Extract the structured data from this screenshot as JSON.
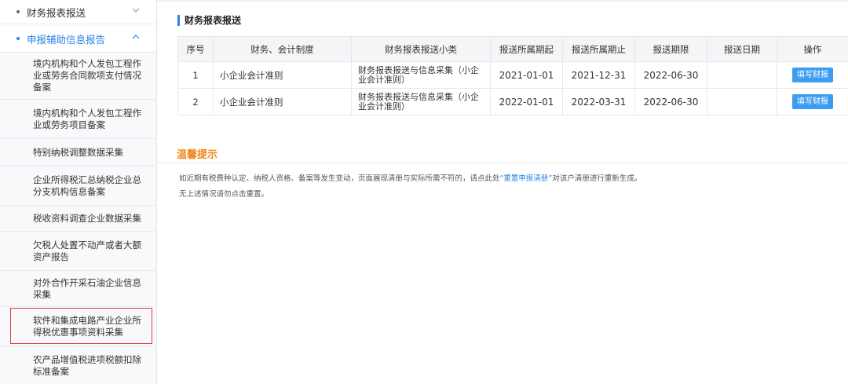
{
  "sidebar": {
    "top_items": [
      {
        "label": "财务报表报送",
        "expanded": false
      },
      {
        "label": "申报辅助信息报告",
        "expanded": true
      }
    ],
    "sub_items": [
      {
        "lines": [
          "境内机构和个人发包工程作",
          "业或劳务合同款项支付情况",
          "备案"
        ]
      },
      {
        "lines": [
          "境内机构和个人发包工程作",
          "业或劳务项目备案"
        ]
      },
      {
        "lines": [
          "特别纳税调整数据采集"
        ]
      },
      {
        "lines": [
          "企业所得税汇总纳税企业总",
          "分支机构信息备案"
        ]
      },
      {
        "lines": [
          "税收资料调查企业数据采集"
        ]
      },
      {
        "lines": [
          "欠税人处置不动产或者大额",
          "资产报告"
        ]
      },
      {
        "lines": [
          "对外合作开采石油企业信息",
          "采集"
        ]
      },
      {
        "lines": [
          "软件和集成电路产业企业所",
          "得税优惠事项资料采集"
        ]
      },
      {
        "lines": [
          "农产品增值税进项税额扣除",
          "标准备案"
        ]
      }
    ]
  },
  "main": {
    "section_title": "财务报表报送",
    "table": {
      "headers": [
        "序号",
        "财务、会计制度",
        "财务报表报送小类",
        "报送所属期起",
        "报送所属期止",
        "报送期限",
        "报送日期",
        "操作"
      ],
      "rows": [
        {
          "no": "1",
          "system": "小企业会计准则",
          "sub_line1": "财务报表报送与信息采集（小企",
          "sub_line2": "业会计准则）",
          "start": "2021-01-01",
          "end": "2021-12-31",
          "deadline": "2022-06-30",
          "date": "",
          "action": "填写财报"
        },
        {
          "no": "2",
          "system": "小企业会计准则",
          "sub_line1": "财务报表报送与信息采集（小企",
          "sub_line2": "业会计准则）",
          "start": "2022-01-01",
          "end": "2022-03-31",
          "deadline": "2022-06-30",
          "date": "",
          "action": "填写财报"
        }
      ]
    },
    "tips": {
      "title": "温馨提示",
      "line1_before": "如近期有税费种认定、纳税人资格、备案等发生变动，页面展现清册与实际所需不符的，请点此处",
      "line1_link": "“重置申报清册”",
      "line1_after": "对该户清册进行重新生成。",
      "line2": "无上述情况请勿点击重置。"
    }
  },
  "colors": {
    "accent": "#2b84e3",
    "tips_title": "#f0861b",
    "button": "#3c9cf0",
    "highlight": "#e03c3c"
  }
}
